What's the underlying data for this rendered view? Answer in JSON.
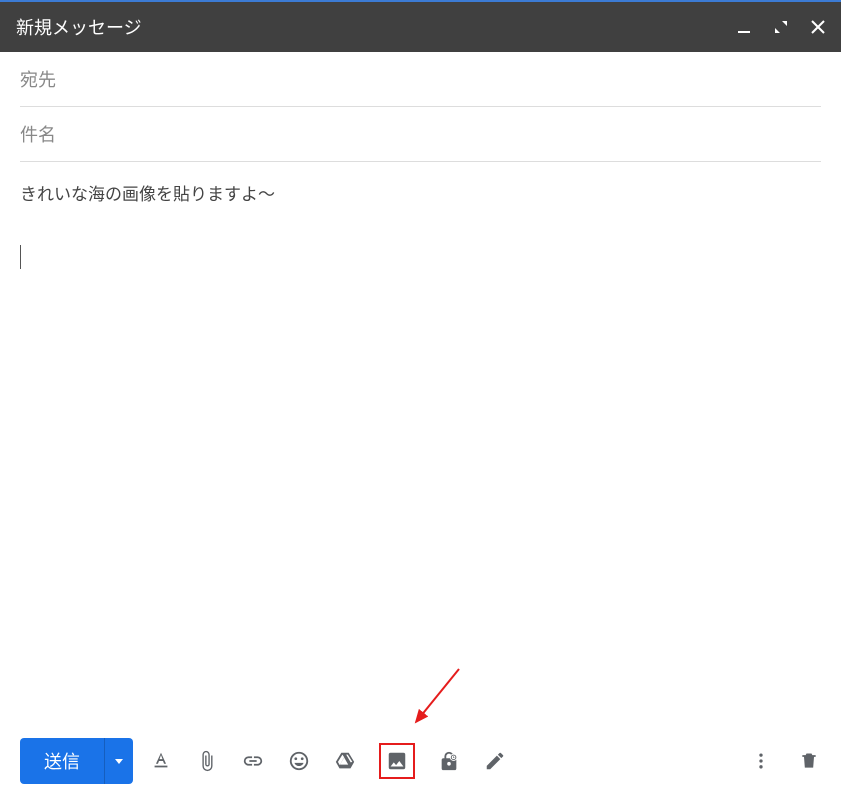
{
  "title": "新規メッセージ",
  "fields": {
    "to_label": "宛先",
    "subject_label": "件名"
  },
  "body": {
    "text": "きれいな海の画像を貼りますよ～"
  },
  "toolbar": {
    "send_label": "送信",
    "icons": {
      "format": "text-format-icon",
      "attach": "attachment-icon",
      "link": "link-icon",
      "emoji": "emoji-icon",
      "drive": "drive-icon",
      "image": "insert-image-icon",
      "confidential": "confidential-icon",
      "signature": "signature-icon",
      "more": "more-menu-icon",
      "delete": "delete-icon"
    }
  },
  "titlebar_icons": {
    "minimize": "minimize-icon",
    "expand": "expand-icon",
    "close": "close-icon"
  }
}
